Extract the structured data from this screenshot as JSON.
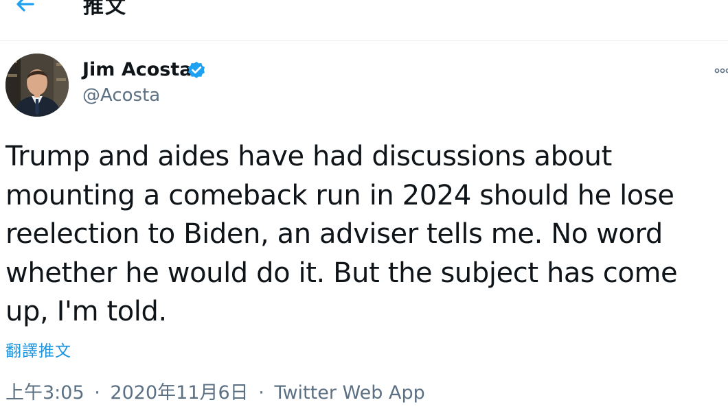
{
  "header": {
    "title": "推文",
    "back_icon": "back-arrow-icon"
  },
  "author": {
    "name": "Jim Acosta",
    "handle": "@Acosta",
    "verified_icon": "verified-badge-icon"
  },
  "tweet": {
    "lines": [
      "Trump and aides have had discussions about",
      "mounting a comeback run in 2024 should he lose",
      "reelection to Biden, an adviser tells me. No word",
      "whether he would do it. But the subject has come",
      "up, I'm told."
    ],
    "translate_label": "翻譯推文"
  },
  "meta": {
    "time": "上午3:05",
    "separator": "·",
    "date": "2020年11月6日",
    "source": "Twitter Web App"
  },
  "colors": {
    "accent": "#1da1f2",
    "link": "#1b95e0",
    "secondary_text": "#5b7083",
    "primary_text": "#0f1419",
    "divider": "#e6ecf0"
  }
}
